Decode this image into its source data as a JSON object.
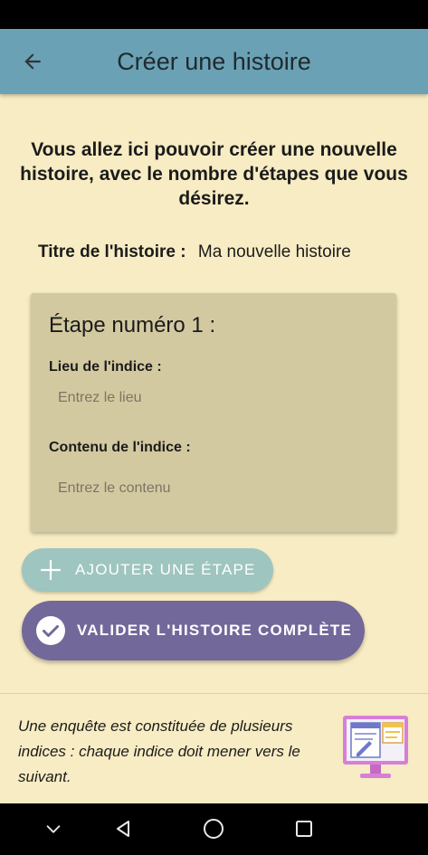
{
  "app_bar": {
    "title": "Créer une histoire",
    "back_icon": "arrow-left-icon"
  },
  "intro": {
    "text": "Vous allez ici pouvoir créer une nouvelle histoire, avec le nombre d'étapes que vous désirez."
  },
  "story_title": {
    "label": "Titre de l'histoire :",
    "value": "Ma nouvelle histoire"
  },
  "step": {
    "title": "Étape numéro 1 :",
    "location_label": "Lieu de l'indice :",
    "location_placeholder": "Entrez le lieu",
    "location_value": "",
    "content_label": "Contenu de l'indice :",
    "content_placeholder": "Entrez le contenu",
    "content_value": ""
  },
  "buttons": {
    "add_step": "AJOUTER UNE ÉTAPE",
    "add_step_icon": "plus-icon",
    "validate": "VALIDER L'HISTOIRE COMPLÈTE",
    "validate_icon": "check-circle-icon"
  },
  "footer": {
    "text": "Une enquête est constituée de plusieurs indices : chaque indice doit mener vers le suivant.",
    "illustration": "monitor-document-illustration"
  },
  "nav_bar": {
    "icons": [
      "chevron-down-icon",
      "back-triangle-icon",
      "home-circle-icon",
      "recents-square-icon"
    ]
  },
  "colors": {
    "app_bar": "#6ba1b4",
    "background": "#f7ecc3",
    "card": "#d3c9a0",
    "add_button": "#9ec5c0",
    "validate_button": "#72689a"
  }
}
